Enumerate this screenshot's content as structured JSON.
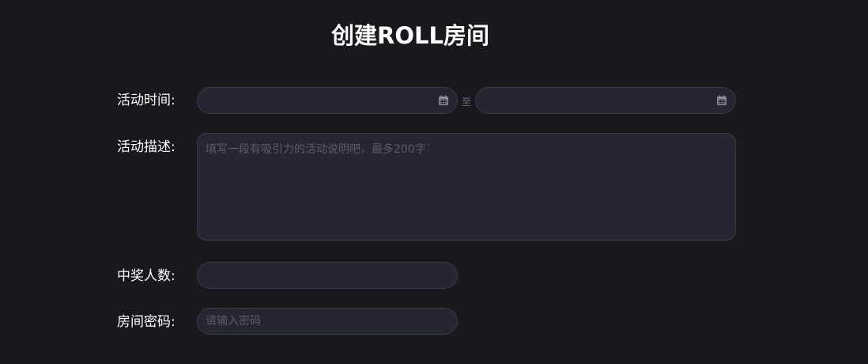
{
  "header": {
    "title": "创建ROLL房间"
  },
  "form": {
    "time_label": "活动时间:",
    "time_separator": "至",
    "start_date": {
      "value": "",
      "icon": "calendar-icon"
    },
    "end_date": {
      "value": "",
      "icon": "calendar-icon"
    },
    "desc_label": "活动描述:",
    "desc_placeholder": "填写一段有吸引力的活动说明吧，最多200字`",
    "winners_label": "中奖人数:",
    "winners_value": "",
    "password_label": "房间密码:",
    "password_placeholder": "请输入密码"
  },
  "colors": {
    "background": "#18181d",
    "field_bg": "#252631",
    "field_border": "#3a3b47",
    "icon": "#8a8ca0"
  }
}
